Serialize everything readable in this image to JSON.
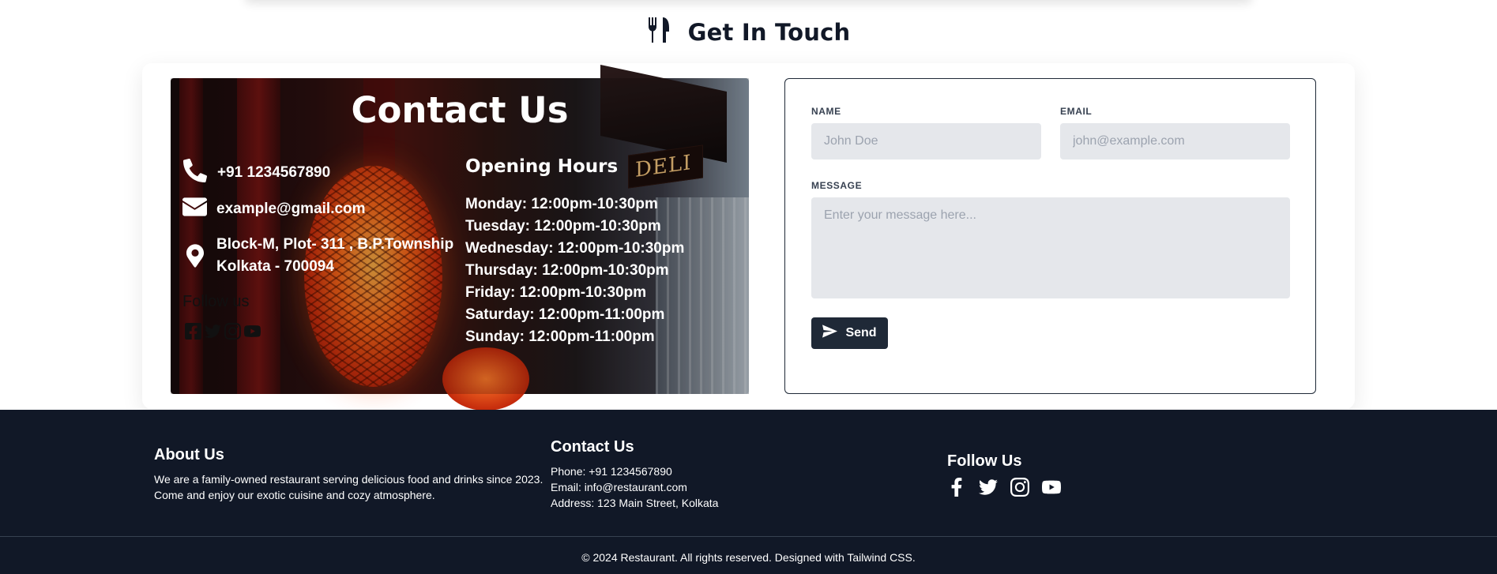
{
  "heading": {
    "title": "Get In Touch",
    "icon": "utensils-icon"
  },
  "contact": {
    "title": "Contact Us",
    "phone": "+91 1234567890",
    "email": "example@gmail.com",
    "address_line1": "Block-M, Plot- 311 , B.P.Township",
    "address_line2": "Kolkata - 700094",
    "follow_label": "Follow us",
    "social_icons": [
      "facebook-icon",
      "twitter-icon",
      "instagram-icon",
      "youtube-icon"
    ],
    "image_sign": "DELI"
  },
  "hours": {
    "title": "Opening Hours",
    "items": [
      "Monday: 12:00pm-10:30pm",
      "Tuesday: 12:00pm-10:30pm",
      "Wednesday: 12:00pm-10:30pm",
      "Thursday: 12:00pm-10:30pm",
      "Friday: 12:00pm-10:30pm",
      "Saturday: 12:00pm-11:00pm",
      "Sunday: 12:00pm-11:00pm"
    ]
  },
  "form": {
    "name_label": "NAME",
    "name_placeholder": "John Doe",
    "email_label": "EMAIL",
    "email_placeholder": "john@example.com",
    "message_label": "MESSAGE",
    "message_placeholder": "Enter your message here...",
    "send_label": "Send"
  },
  "footer": {
    "about_title": "About Us",
    "about_line1": "We are a family-owned restaurant serving delicious food and drinks since 2023.",
    "about_line2": "Come and enjoy our exotic cuisine and cozy atmosphere.",
    "contact_title": "Contact Us",
    "phone": "Phone: +91 1234567890",
    "email": "Email: info@restaurant.com",
    "address": "Address: 123 Main Street, Kolkata",
    "follow_title": "Follow Us",
    "social_icons": [
      "facebook-icon",
      "twitter-icon",
      "instagram-icon",
      "youtube-icon"
    ],
    "copyright": "© 2024 Restaurant. All rights reserved. Designed with Tailwind CSS."
  }
}
